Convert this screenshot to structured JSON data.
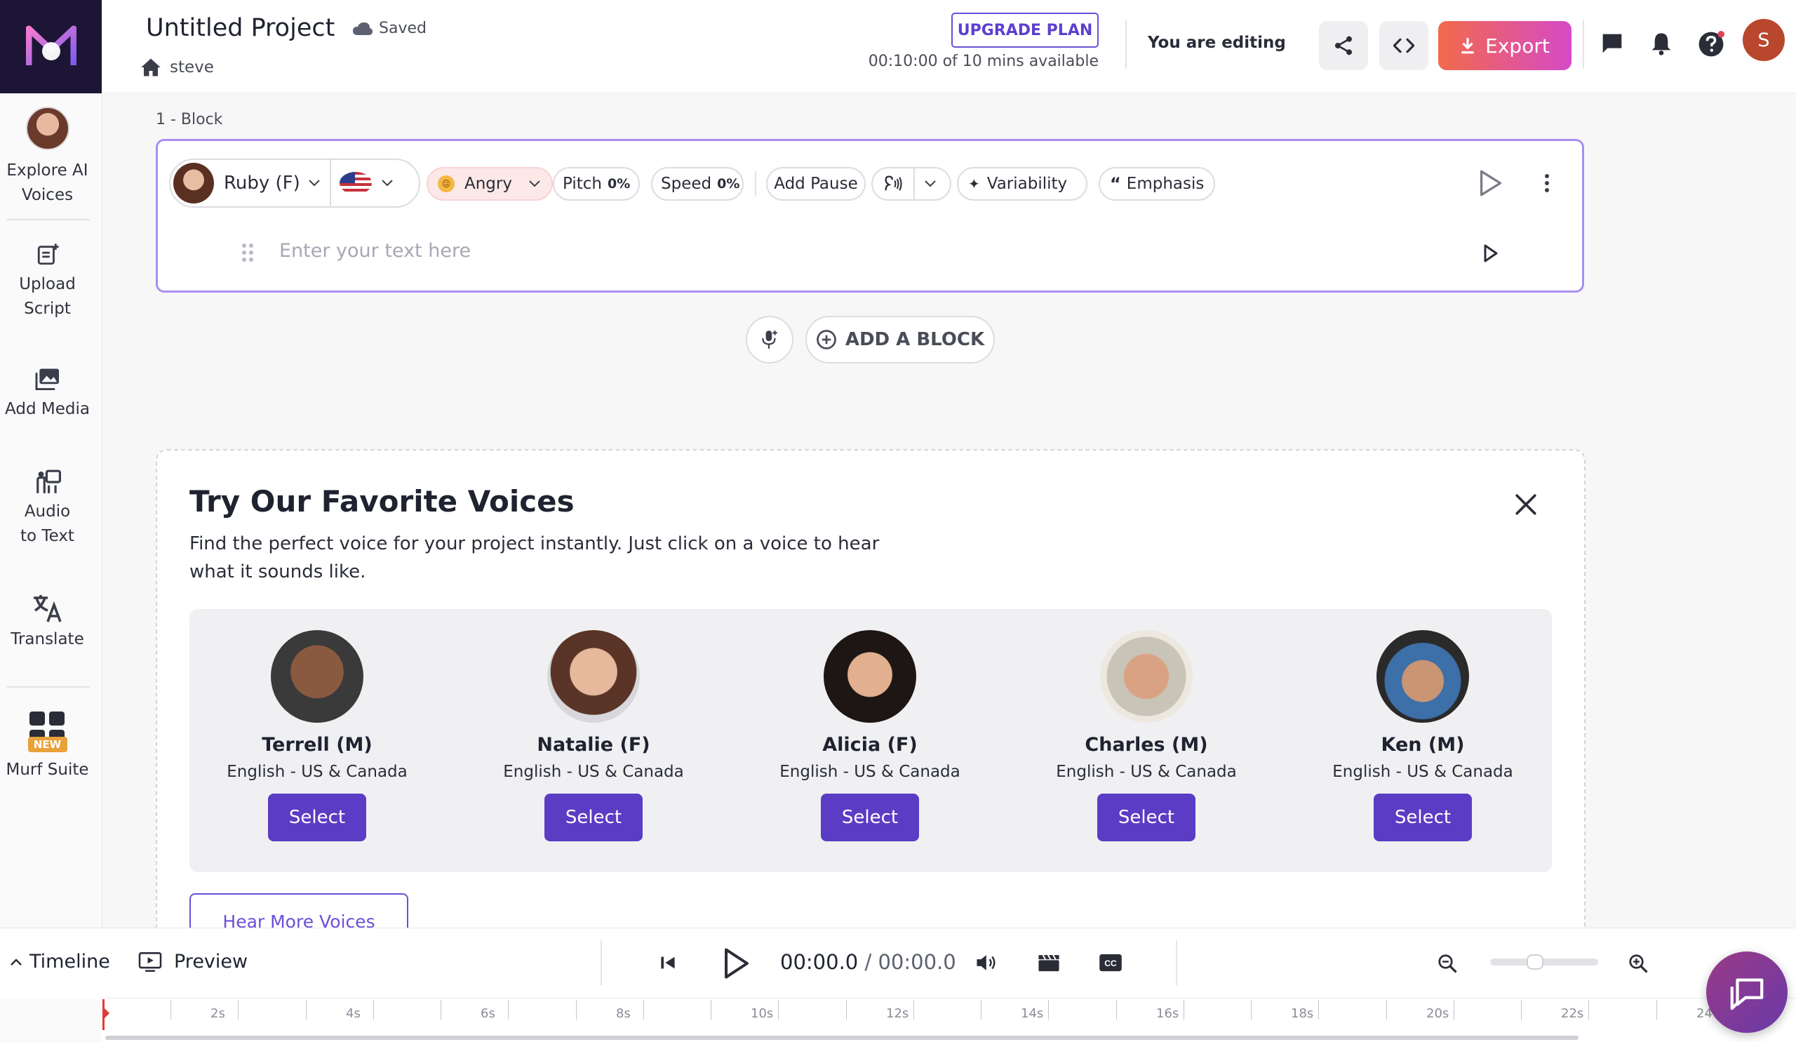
{
  "header": {
    "project_title": "Untitled Project",
    "save_status": "Saved",
    "owner": "steve",
    "upgrade_label": "UPGRADE PLAN",
    "minutes_used": "00:10:00 of 10 mins available",
    "editing_status": "You are editing",
    "export_label": "Export",
    "user_initial": "S"
  },
  "sidebar": {
    "items": [
      {
        "label": "Explore AI Voices",
        "icon": "voice-avatar"
      },
      {
        "label": "Upload Script",
        "icon": "upload-script-icon"
      },
      {
        "label": "Add Media",
        "icon": "media-icon"
      },
      {
        "label": "Audio to Text",
        "icon": "audio-to-text-icon"
      },
      {
        "label": "Translate",
        "icon": "translate-icon"
      },
      {
        "label": "Murf Suite",
        "icon": "grid-icon",
        "badge": "NEW"
      }
    ]
  },
  "block": {
    "label": "1 -  Block",
    "voice": "Ruby (F)",
    "emotion": "Angry",
    "pitch_label": "Pitch",
    "pitch_value": "0%",
    "speed_label": "Speed",
    "speed_value": "0%",
    "add_pause_label": "Add Pause",
    "variability_label": "Variability",
    "emphasis_label": "Emphasis",
    "text_placeholder": "Enter your text here"
  },
  "add_block_label": "ADD A BLOCK",
  "favorites": {
    "title": "Try Our Favorite Voices",
    "subtitle": "Find the perfect voice for your project instantly. Just click on a voice to hear what it sounds like.",
    "voices": [
      {
        "name": "Terrell (M)",
        "language": "English - US & Canada",
        "select_label": "Select"
      },
      {
        "name": "Natalie (F)",
        "language": "English - US & Canada",
        "select_label": "Select"
      },
      {
        "name": "Alicia (F)",
        "language": "English - US & Canada",
        "select_label": "Select"
      },
      {
        "name": "Charles (M)",
        "language": "English - US & Canada",
        "select_label": "Select"
      },
      {
        "name": "Ken (M)",
        "language": "English - US & Canada",
        "select_label": "Select"
      }
    ],
    "hear_more_label": "Hear More Voices"
  },
  "player": {
    "timeline_label": "Timeline",
    "preview_label": "Preview",
    "current_time": "00:00.0",
    "time_separator": " / ",
    "total_time": "00:00.0"
  },
  "ruler": {
    "labels": [
      "2s",
      "4s",
      "6s",
      "8s",
      "10s",
      "12s",
      "14s",
      "16s",
      "18s",
      "20s",
      "22s",
      "24"
    ]
  },
  "colors": {
    "accent": "#5b3cc4",
    "export_gradient_start": "#f26a4a",
    "export_gradient_end": "#d64ac8",
    "block_border": "#a98ff0"
  }
}
